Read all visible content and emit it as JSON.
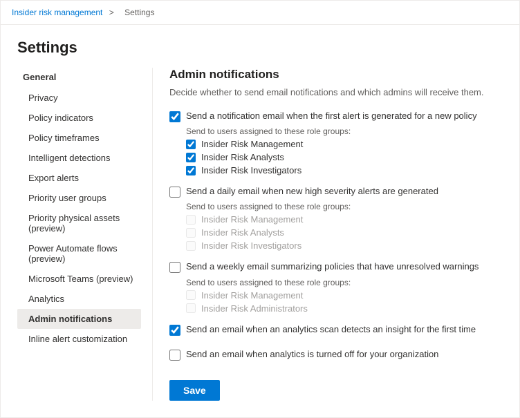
{
  "breadcrumb": {
    "parent": "Insider risk management",
    "separator": ">",
    "current": "Settings"
  },
  "page_title": "Settings",
  "sidebar": {
    "section_label": "General",
    "items": [
      {
        "label": "Privacy",
        "active": false
      },
      {
        "label": "Policy indicators",
        "active": false
      },
      {
        "label": "Policy timeframes",
        "active": false
      },
      {
        "label": "Intelligent detections",
        "active": false
      },
      {
        "label": "Export alerts",
        "active": false
      },
      {
        "label": "Priority user groups",
        "active": false
      },
      {
        "label": "Priority physical assets (preview)",
        "active": false
      },
      {
        "label": "Power Automate flows (preview)",
        "active": false
      },
      {
        "label": "Microsoft Teams (preview)",
        "active": false
      },
      {
        "label": "Analytics",
        "active": false
      },
      {
        "label": "Admin notifications",
        "active": true
      },
      {
        "label": "Inline alert customization",
        "active": false
      }
    ]
  },
  "main": {
    "title": "Admin notifications",
    "description": "Decide whether to send email notifications and which admins will receive them.",
    "notification1": {
      "label": "Send a notification email when the first alert is generated for a new policy",
      "checked": true,
      "role_groups_label": "Send to users assigned to these role groups:",
      "roles": [
        {
          "label": "Insider Risk Management",
          "checked": true,
          "disabled": false
        },
        {
          "label": "Insider Risk Analysts",
          "checked": true,
          "disabled": false
        },
        {
          "label": "Insider Risk Investigators",
          "checked": true,
          "disabled": false
        }
      ]
    },
    "notification2": {
      "label": "Send a daily email when new high severity alerts are generated",
      "checked": false,
      "role_groups_label": "Send to users assigned to these role groups:",
      "roles": [
        {
          "label": "Insider Risk Management",
          "checked": false,
          "disabled": true
        },
        {
          "label": "Insider Risk Analysts",
          "checked": false,
          "disabled": true
        },
        {
          "label": "Insider Risk Investigators",
          "checked": false,
          "disabled": true
        }
      ]
    },
    "notification3": {
      "label": "Send a weekly email summarizing policies that have unresolved warnings",
      "checked": false,
      "role_groups_label": "Send to users assigned to these role groups:",
      "roles": [
        {
          "label": "Insider Risk Management",
          "checked": false,
          "disabled": true
        },
        {
          "label": "Insider Risk Administrators",
          "checked": false,
          "disabled": true
        }
      ]
    },
    "notification4": {
      "label": "Send an email when an analytics scan detects an insight for the first time",
      "checked": true
    },
    "notification5": {
      "label": "Send an email when analytics is turned off for your organization",
      "checked": false
    },
    "save_button": "Save"
  }
}
